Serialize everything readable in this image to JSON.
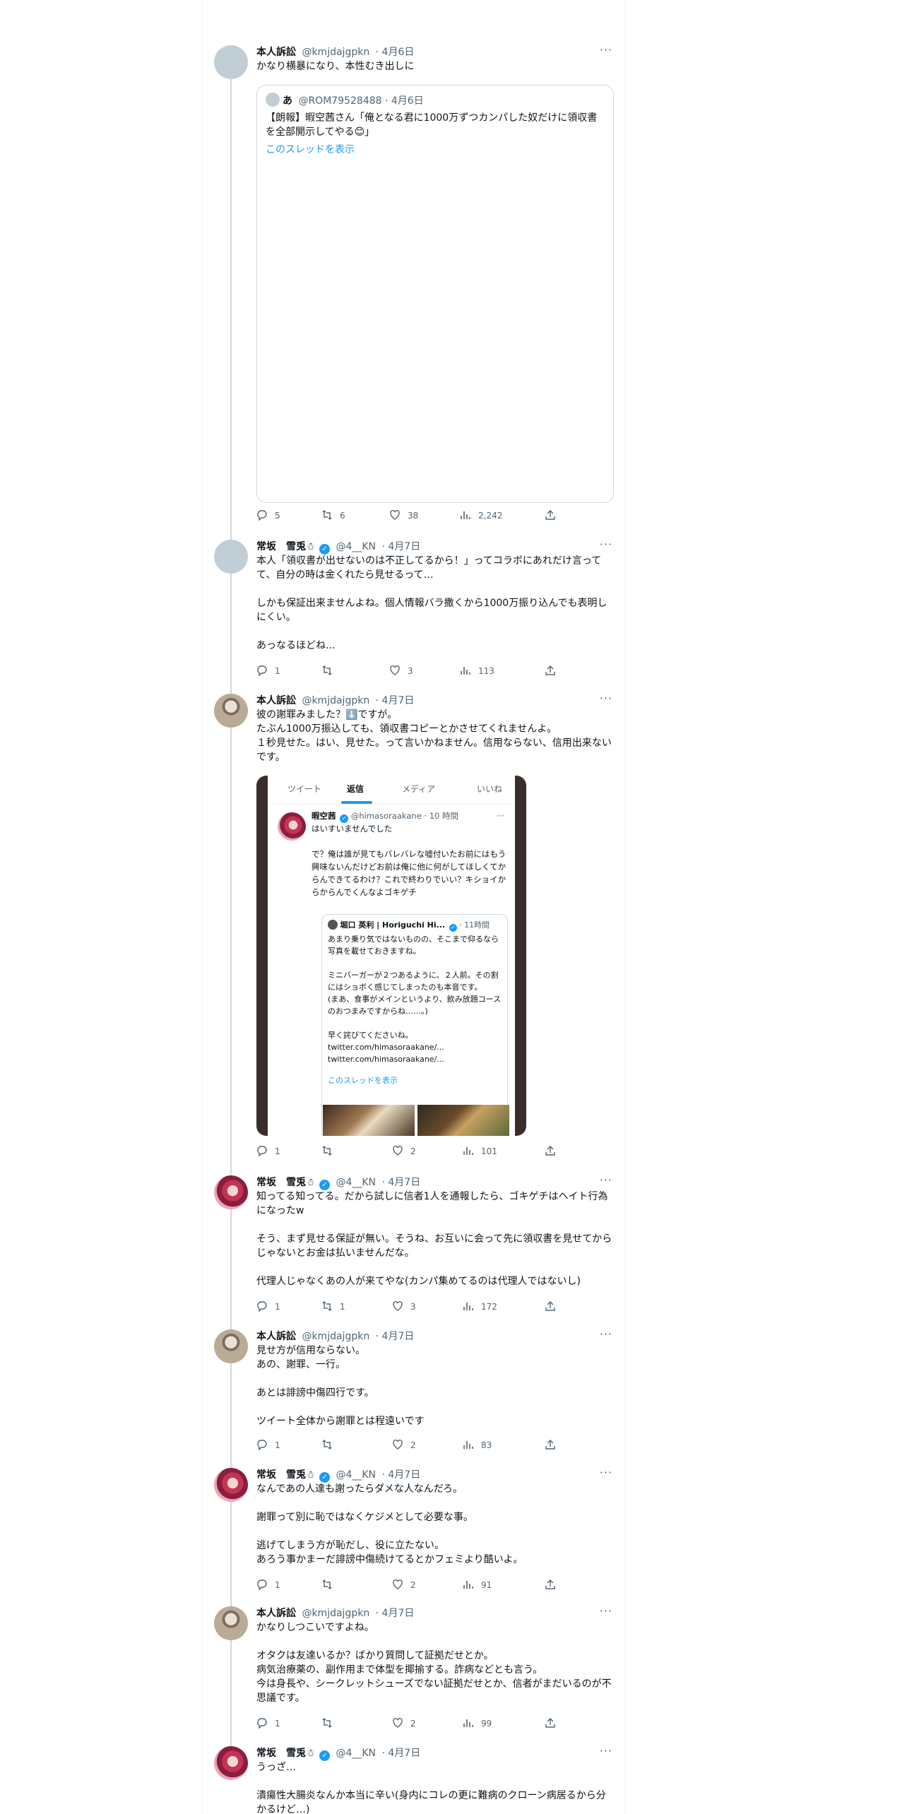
{
  "tweets": [
    {
      "name": "本人訴訟",
      "handle": "@kmjdajgpkn",
      "date": "· 4月6日",
      "more": "···",
      "text": "かなり横暴になり、本性むき出しに",
      "quote": {
        "name": "あ",
        "handle": "@ROM79528488 · 4月6日",
        "text": "【朗報】暇空茜さん「俺となる君に1000万ずつカンパした奴だけに領収書を全部開示してやる😊」",
        "link": "このスレッドを表示"
      },
      "replies": "5",
      "retweets": "6",
      "likes": "38",
      "views": "2,242"
    },
    {
      "name": "常坂　雪兎☃",
      "handle": "@4__KN",
      "date": "· 4月7日",
      "more": "···",
      "text": "本人「領収書が出せないのは不正してるから！」ってコラボにあれだけ言ってて、自分の時は金くれたら見せるって…\n\nしかも保証出来ませんよね。個人情報バラ撒くから1000万振り込んでも表明しにくい。\n\nあっなるほどね…",
      "replies": "1",
      "retweets": "",
      "likes": "3",
      "views": "113"
    },
    {
      "name": "本人訴訟",
      "handle": "@kmjdajgpkn",
      "date": "· 4月7日",
      "more": "···",
      "text": "彼の謝罪みました？⬇️ですが。\nたぶん1000万振込しても、領収書コピーとかさせてくれませんよ。\n１秒見せた。はい、見せた。って言いかねません。信用ならない、信用出来ないです。",
      "screenshot": {
        "tabs": [
          "ツイート",
          "返信",
          "メディア",
          "いいね"
        ],
        "name": "暇空茜",
        "handle": "@himasoraakane · 10 時間",
        "reply_to": "はいすいませんでした",
        "text": "で？俺は誰が見てもバレバレな嘘付いたお前にはもう興味ないんだけどお前は俺に他に何がしてほしくてからんできてるわけ？これで終わりでいい？キショイからからんでくんなよゴキゲチ",
        "quote_name": "堀口 英利 | Horiguchi Hi...",
        "quote_time": "· 11時間",
        "quote_text": "あまり乗り気ではないものの、そこまで仰るなら写真を載せておきますね。\n\nミニバーガーが２つあるように、２人前。その割にはショボく感じてしまったのも本音です。\n(まあ、食事がメインというより、飲み放題コースのおつまみですからね……。)\n\n早く詫びてくださいね。\ntwitter.com/himasoraakane/...\ntwitter.com/himasoraakane/...",
        "quote_link": "このスレッドを表示",
        "more": "···"
      },
      "replies": "1",
      "retweets": "",
      "likes": "2",
      "views": "101"
    },
    {
      "name": "常坂　雪兎☃",
      "handle": "@4__KN",
      "date": "· 4月7日",
      "more": "···",
      "text": "知ってる知ってる。だから試しに信者1人を通報したら、ゴキゲチはヘイト行為になったw\n\nそう、まず見せる保証が無い。そうね、お互いに会って先に領収書を見せてからじゃないとお金は払いませんだな。\n\n代理人じゃなくあの人が来てやな(カンパ集めてるのは代理人ではないし)",
      "replies": "1",
      "retweets": "1",
      "likes": "3",
      "views": "172"
    },
    {
      "name": "本人訴訟",
      "handle": "@kmjdajgpkn",
      "date": "· 4月7日",
      "more": "···",
      "text": "見せ方が信用ならない。\nあの、謝罪、一行。\n\nあとは誹謗中傷四行です。\n\nツイート全体から謝罪とは程遠いです",
      "replies": "1",
      "retweets": "",
      "likes": "2",
      "views": "83"
    },
    {
      "name": "常坂　雪兎☃",
      "handle": "@4__KN",
      "date": "· 4月7日",
      "more": "···",
      "text": "なんであの人達も謝ったらダメな人なんだろ。\n\n謝罪って別に恥ではなくケジメとして必要な事。\n\n逃げてしまう方が恥だし、役に立たない。\nあろう事かまーだ誹謗中傷続けてるとかフェミより酷いよ。",
      "replies": "1",
      "retweets": "",
      "likes": "2",
      "views": "91"
    },
    {
      "name": "本人訴訟",
      "handle": "@kmjdajgpkn",
      "date": "· 4月7日",
      "more": "···",
      "text": "かなりしつこいですよね。\n\nオタクは友達いるか？ばかり質問して証拠だせとか。\n病気治療薬の、副作用まで体型を揶揄する。詐病などとも言う。\n今は身長や、シークレットシューズでない証拠だせとか、信者がまだいるのが不思議です。",
      "replies": "1",
      "retweets": "",
      "likes": "2",
      "views": "99"
    },
    {
      "name": "常坂　雪兎☃",
      "handle": "@4__KN",
      "date": "· 4月7日",
      "more": "···",
      "text": "うっざ…\n\n潰瘍性大腸炎なんか本当に辛い(身内にコレの更に難病のクローン病居るから分かるけど…)"
    }
  ]
}
